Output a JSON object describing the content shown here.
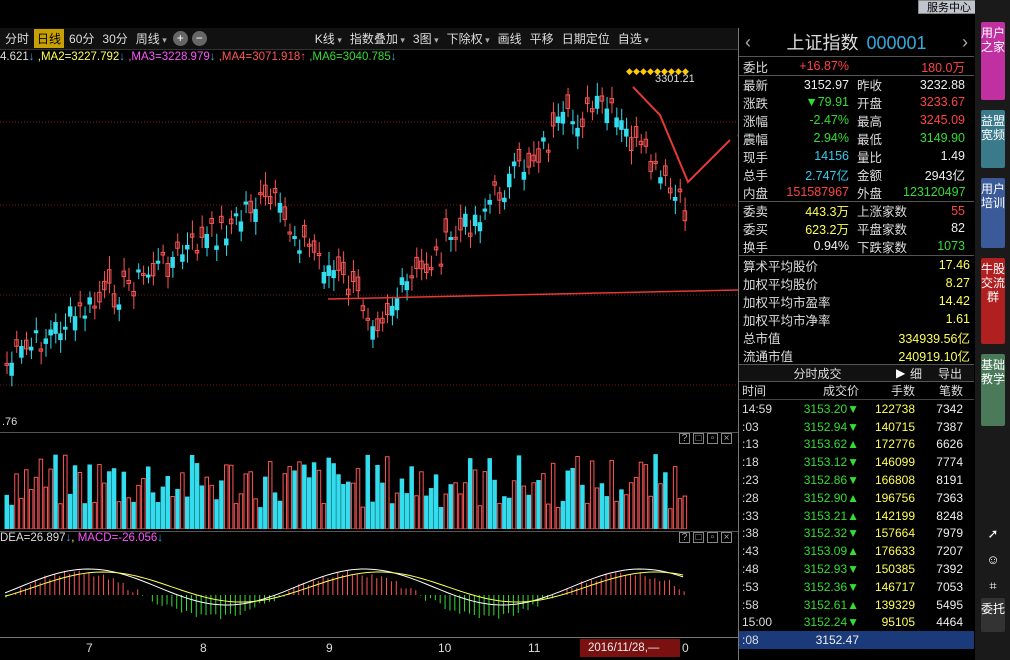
{
  "window": {
    "service_label": "服务中心",
    "close_icon": "close-icon"
  },
  "toolbar": {
    "items": [
      "分时",
      "日线",
      "60分",
      "30分",
      "周线"
    ],
    "active_index": 1,
    "plus": "+",
    "minus": "−",
    "right": [
      "K线",
      "指数叠加",
      "3图",
      "下除权",
      "画线",
      "平移",
      "日期定位",
      "自选"
    ]
  },
  "ma": {
    "ma1": "4.621",
    "ma2": "MA2=3227.792",
    "ma3": "MA3=3228.979",
    "ma4": "MA4=3071.918",
    "ma6": "MA6=3040.785"
  },
  "chart": {
    "high_label": "3301.21",
    "low_label": ".76",
    "colors": {
      "up": "#ff5555",
      "down": "#33ddee",
      "grid": "#7a1a1a",
      "arrow": "#e53935"
    }
  },
  "macd": {
    "dea": "DEA=26.897",
    "macd": "MACD=-26.056"
  },
  "xaxis": {
    "labels": [
      "7",
      "8",
      "9",
      "10",
      "11"
    ],
    "date": "2016/11/28,—",
    "end": "0"
  },
  "quote": {
    "name": "上证指数",
    "code": "000001",
    "rows": [
      {
        "l1": "委比",
        "v1": "+16.87%",
        "l2": "",
        "v2": "180.0万"
      },
      {
        "l1": "最新",
        "v1": "3152.97",
        "l2": "昨收",
        "v2": "3232.88"
      },
      {
        "l1": "涨跌",
        "v1": "▼79.91",
        "l2": "开盘",
        "v2": "3233.67"
      },
      {
        "l1": "涨幅",
        "v1": "-2.47%",
        "l2": "最高",
        "v2": "3245.09"
      },
      {
        "l1": "震幅",
        "v1": "2.94%",
        "l2": "最低",
        "v2": "3149.90"
      },
      {
        "l1": "现手",
        "v1": "14156",
        "l2": "量比",
        "v2": "1.49"
      },
      {
        "l1": "总手",
        "v1": "2.747亿",
        "l2": "金额",
        "v2": "2943亿"
      },
      {
        "l1": "内盘",
        "v1": "151587967",
        "l2": "外盘",
        "v2": "123120497"
      },
      {
        "l1": "委卖",
        "v1": "443.3万",
        "l2": "上涨家数",
        "v2": "55"
      },
      {
        "l1": "委买",
        "v1": "623.2万",
        "l2": "平盘家数",
        "v2": "82"
      },
      {
        "l1": "换手",
        "v1": "0.94%",
        "l2": "下跌家数",
        "v2": "1073"
      }
    ],
    "wide": [
      {
        "label": "算术平均股价",
        "value": "17.46"
      },
      {
        "label": "加权平均股价",
        "value": "8.27"
      },
      {
        "label": "加权平均市盈率",
        "value": "14.42"
      },
      {
        "label": "加权平均市净率",
        "value": "1.61"
      },
      {
        "label": "总市值",
        "value": "334939.56亿"
      },
      {
        "label": "流通市值",
        "value": "240919.10亿"
      }
    ]
  },
  "ticks": {
    "title": "分时成交",
    "detail": "细",
    "export": "导出",
    "cols": [
      "时间",
      "成交价",
      "手数",
      "笔数"
    ],
    "rows": [
      {
        "t": "14:59",
        "p": "3153.20▼",
        "v": "122738",
        "n": "7342",
        "dir": "down"
      },
      {
        "t": ":03",
        "p": "3152.94▼",
        "v": "140715",
        "n": "7387",
        "dir": "down"
      },
      {
        "t": ":13",
        "p": "3153.62▲",
        "v": "172776",
        "n": "6626",
        "dir": "up"
      },
      {
        "t": ":18",
        "p": "3153.12▼",
        "v": "146099",
        "n": "7774",
        "dir": "down"
      },
      {
        "t": ":23",
        "p": "3152.86▼",
        "v": "166808",
        "n": "8191",
        "dir": "down"
      },
      {
        "t": ":28",
        "p": "3152.90▲",
        "v": "196756",
        "n": "7363",
        "dir": "up"
      },
      {
        "t": ":33",
        "p": "3153.21▲",
        "v": "142199",
        "n": "8248",
        "dir": "up"
      },
      {
        "t": ":38",
        "p": "3152.32▼",
        "v": "157664",
        "n": "7979",
        "dir": "down"
      },
      {
        "t": ":43",
        "p": "3153.09▲",
        "v": "176633",
        "n": "7207",
        "dir": "up"
      },
      {
        "t": ":48",
        "p": "3152.93▼",
        "v": "150385",
        "n": "7392",
        "dir": "down"
      },
      {
        "t": ":53",
        "p": "3152.36▼",
        "v": "146717",
        "n": "7053",
        "dir": "down"
      },
      {
        "t": ":58",
        "p": "3152.61▲",
        "v": "139329",
        "n": "5495",
        "dir": "up"
      },
      {
        "t": "15:00",
        "p": "3152.24▼",
        "v": "95105",
        "n": "4464",
        "dir": "down"
      },
      {
        "t": ":08",
        "p": "3152.47",
        "v": "",
        "n": "",
        "dir": "none"
      }
    ]
  },
  "side": {
    "tabs": [
      "用户之家",
      "益盟宽频",
      "用户培训",
      "牛股交流群",
      "基础教学"
    ],
    "tail": "委托"
  }
}
